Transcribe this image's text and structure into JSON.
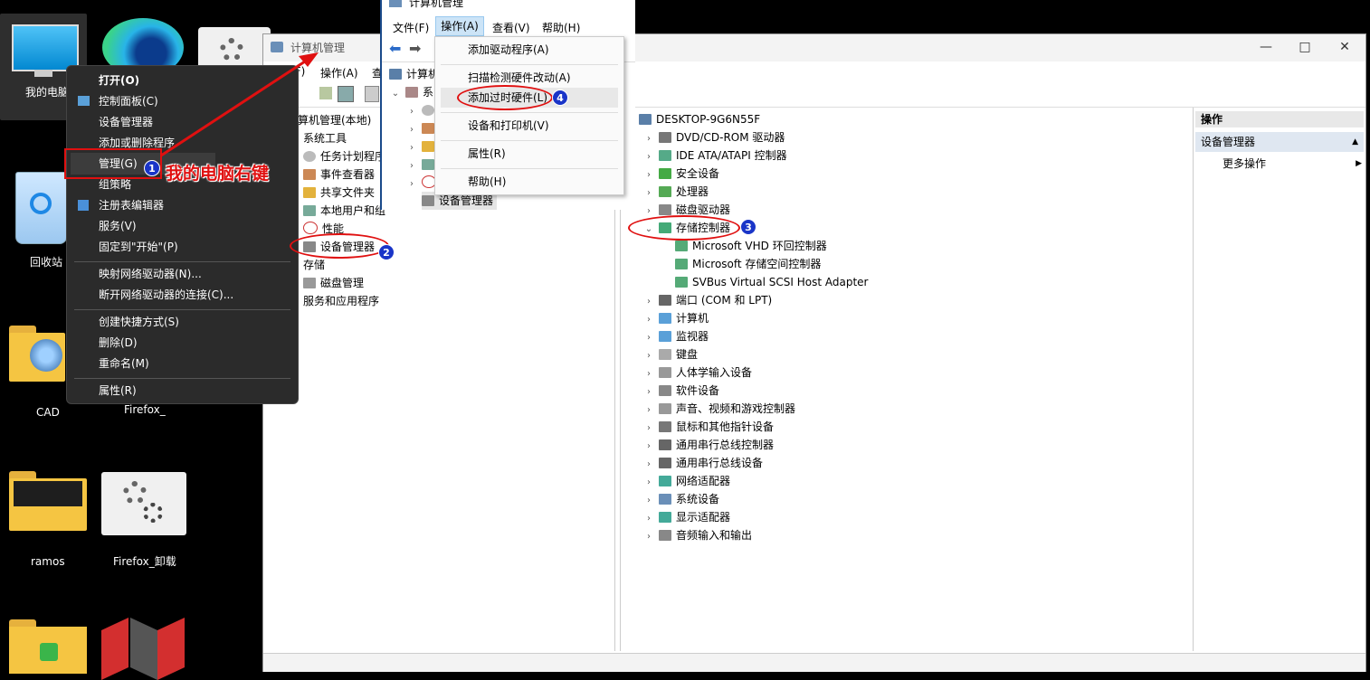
{
  "desktop": {
    "icons": [
      {
        "label": "我的电脑"
      },
      {
        "label": "回收站"
      },
      {
        "label": "CAD"
      },
      {
        "label": "Firefox_"
      },
      {
        "label": "ramos"
      },
      {
        "label": "Firefox_卸载"
      }
    ]
  },
  "context_menu": {
    "items": [
      "打开(O)",
      "控制面板(C)",
      "设备管理器",
      "添加或删除程序",
      "管理(G)",
      "组策略",
      "注册表编辑器",
      "服务(V)",
      "固定到\"开始\"(P)",
      "映射网络驱动器(N)...",
      "断开网络驱动器的连接(C)...",
      "创建快捷方式(S)",
      "删除(D)",
      "重命名(M)",
      "属性(R)"
    ]
  },
  "annotation": {
    "step1_text": "我的电脑右键",
    "badges": [
      "1",
      "2",
      "3",
      "4"
    ]
  },
  "main_window": {
    "title": "计算机管理",
    "menu": [
      "(F)",
      "操作(A)",
      "查"
    ],
    "left_tree": [
      "算机管理(本地)",
      "系统工具",
      "任务计划程序",
      "事件查看器",
      "共享文件夹",
      "本地用户和组",
      "性能",
      "设备管理器",
      "存储",
      "磁盘管理",
      "服务和应用程序"
    ],
    "device_tree": {
      "root": "DESKTOP-9G6N55F",
      "items": [
        "DVD/CD-ROM 驱动器",
        "IDE ATA/ATAPI 控制器",
        "安全设备",
        "处理器",
        "磁盘驱动器",
        "存储控制器",
        "Microsoft VHD 环回控制器",
        "Microsoft 存储空间控制器",
        "SVBus Virtual SCSI Host Adapter",
        "端口 (COM 和 LPT)",
        "计算机",
        "监视器",
        "键盘",
        "人体学输入设备",
        "软件设备",
        "声音、视频和游戏控制器",
        "鼠标和其他指针设备",
        "通用串行总线控制器",
        "通用串行总线设备",
        "网络适配器",
        "系统设备",
        "显示适配器",
        "音频输入和输出"
      ]
    },
    "actions_pane": {
      "header": "操作",
      "section": "设备管理器",
      "more": "更多操作"
    }
  },
  "popup_window": {
    "title": "计算机管理",
    "menu": [
      "文件(F)",
      "操作(A)",
      "查看(V)",
      "帮助(H)"
    ],
    "tree": [
      "计算机",
      "系",
      "设备管理器"
    ]
  },
  "action_menu": {
    "items": [
      "添加驱动程序(A)",
      "扫描检测硬件改动(A)",
      "添加过时硬件(L)",
      "设备和打印机(V)",
      "属性(R)",
      "帮助(H)"
    ]
  }
}
